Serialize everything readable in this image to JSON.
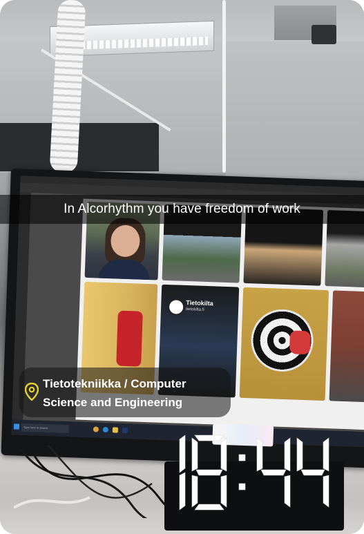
{
  "caption": {
    "text": "In Alcorhythm you have freedom of work"
  },
  "location_sticker": {
    "icon": "location-pin-icon",
    "line1": "Tietotekniikka / Computer",
    "line2": "Science and Engineering",
    "pin_color": "#e7d22a"
  },
  "time_sticker": {
    "text": "18:44",
    "color": "#ffffff"
  },
  "screen_tiles": {
    "tik_logo_text": "Tietokilta",
    "tik_logo_sub": "tietokilta.fi"
  },
  "taskbar": {
    "search_placeholder": "Type here to search"
  }
}
